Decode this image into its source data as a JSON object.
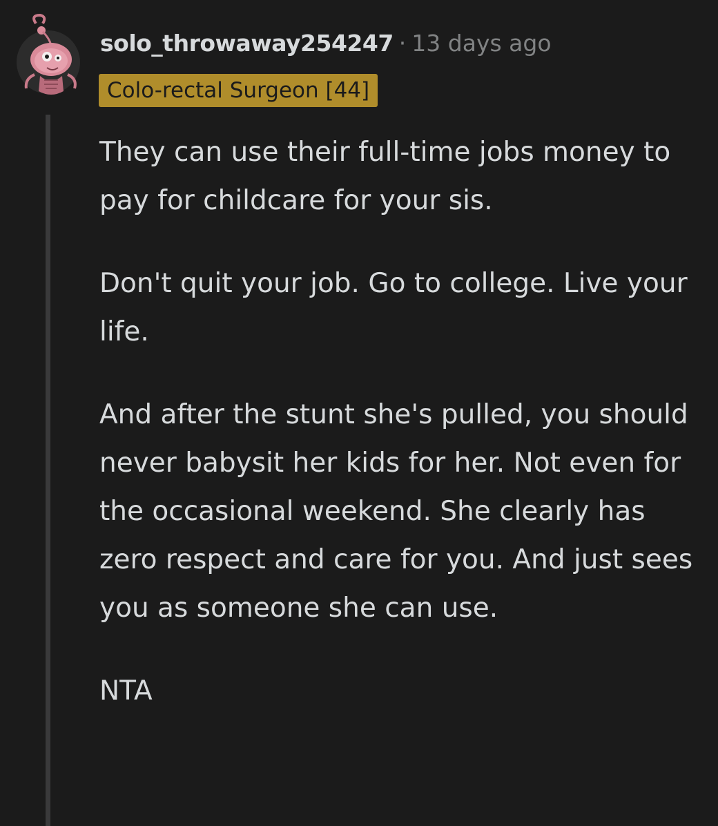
{
  "comment": {
    "username": "solo_throwaway254247",
    "separator": "·",
    "timestamp": "13 days ago",
    "flair": "Colo-rectal Surgeon [44]",
    "avatar_icon": "snoo-avatar-icon",
    "paragraphs": [
      "They can use their full-time jobs money to pay for childcare for your sis.",
      "Don't quit your job. Go to college. Live your life.",
      "And after the stunt she's pulled, you should never babysit her kids for her. Not even for the occasional weekend. She clearly has zero respect and care for you. And just sees you as someone she can use.",
      "NTA"
    ]
  },
  "colors": {
    "background": "#1b1b1b",
    "text": "#d7dadc",
    "meta": "#818384",
    "flair_bg": "#b08d2b",
    "thread_line": "#3a3a3b",
    "avatar_accent": "#d98a99"
  }
}
